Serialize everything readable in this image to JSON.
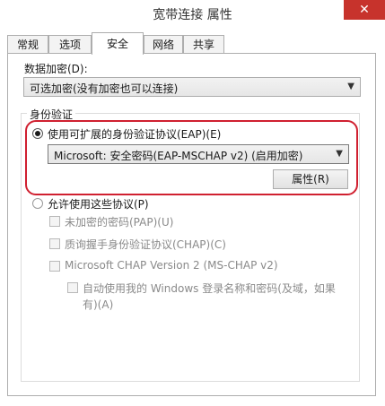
{
  "window": {
    "title": "宽带连接 属性",
    "close_label": "✕"
  },
  "tabs": [
    "常规",
    "选项",
    "安全",
    "网络",
    "共享"
  ],
  "data_encryption": {
    "label": "数据加密(D):",
    "value": "可选加密(没有加密也可以连接)"
  },
  "auth": {
    "group_title": "身份验证",
    "eap_radio_label": "使用可扩展的身份验证协议(EAP)(E)",
    "eap_method": "Microsoft: 安全密码(EAP-MSCHAP v2) (启用加密)",
    "properties_button": "属性(R)",
    "allow_protocols_label": "允许使用这些协议(P)",
    "protocols": [
      "未加密的密码(PAP)(U)",
      "质询握手身份验证协议(CHAP)(C)",
      "Microsoft CHAP Version 2 (MS-CHAP v2)"
    ],
    "auto_windows_line1": "自动使用我的 Windows 登录名称和密码(及域，如果",
    "auto_windows_line2": "有)(A)"
  }
}
